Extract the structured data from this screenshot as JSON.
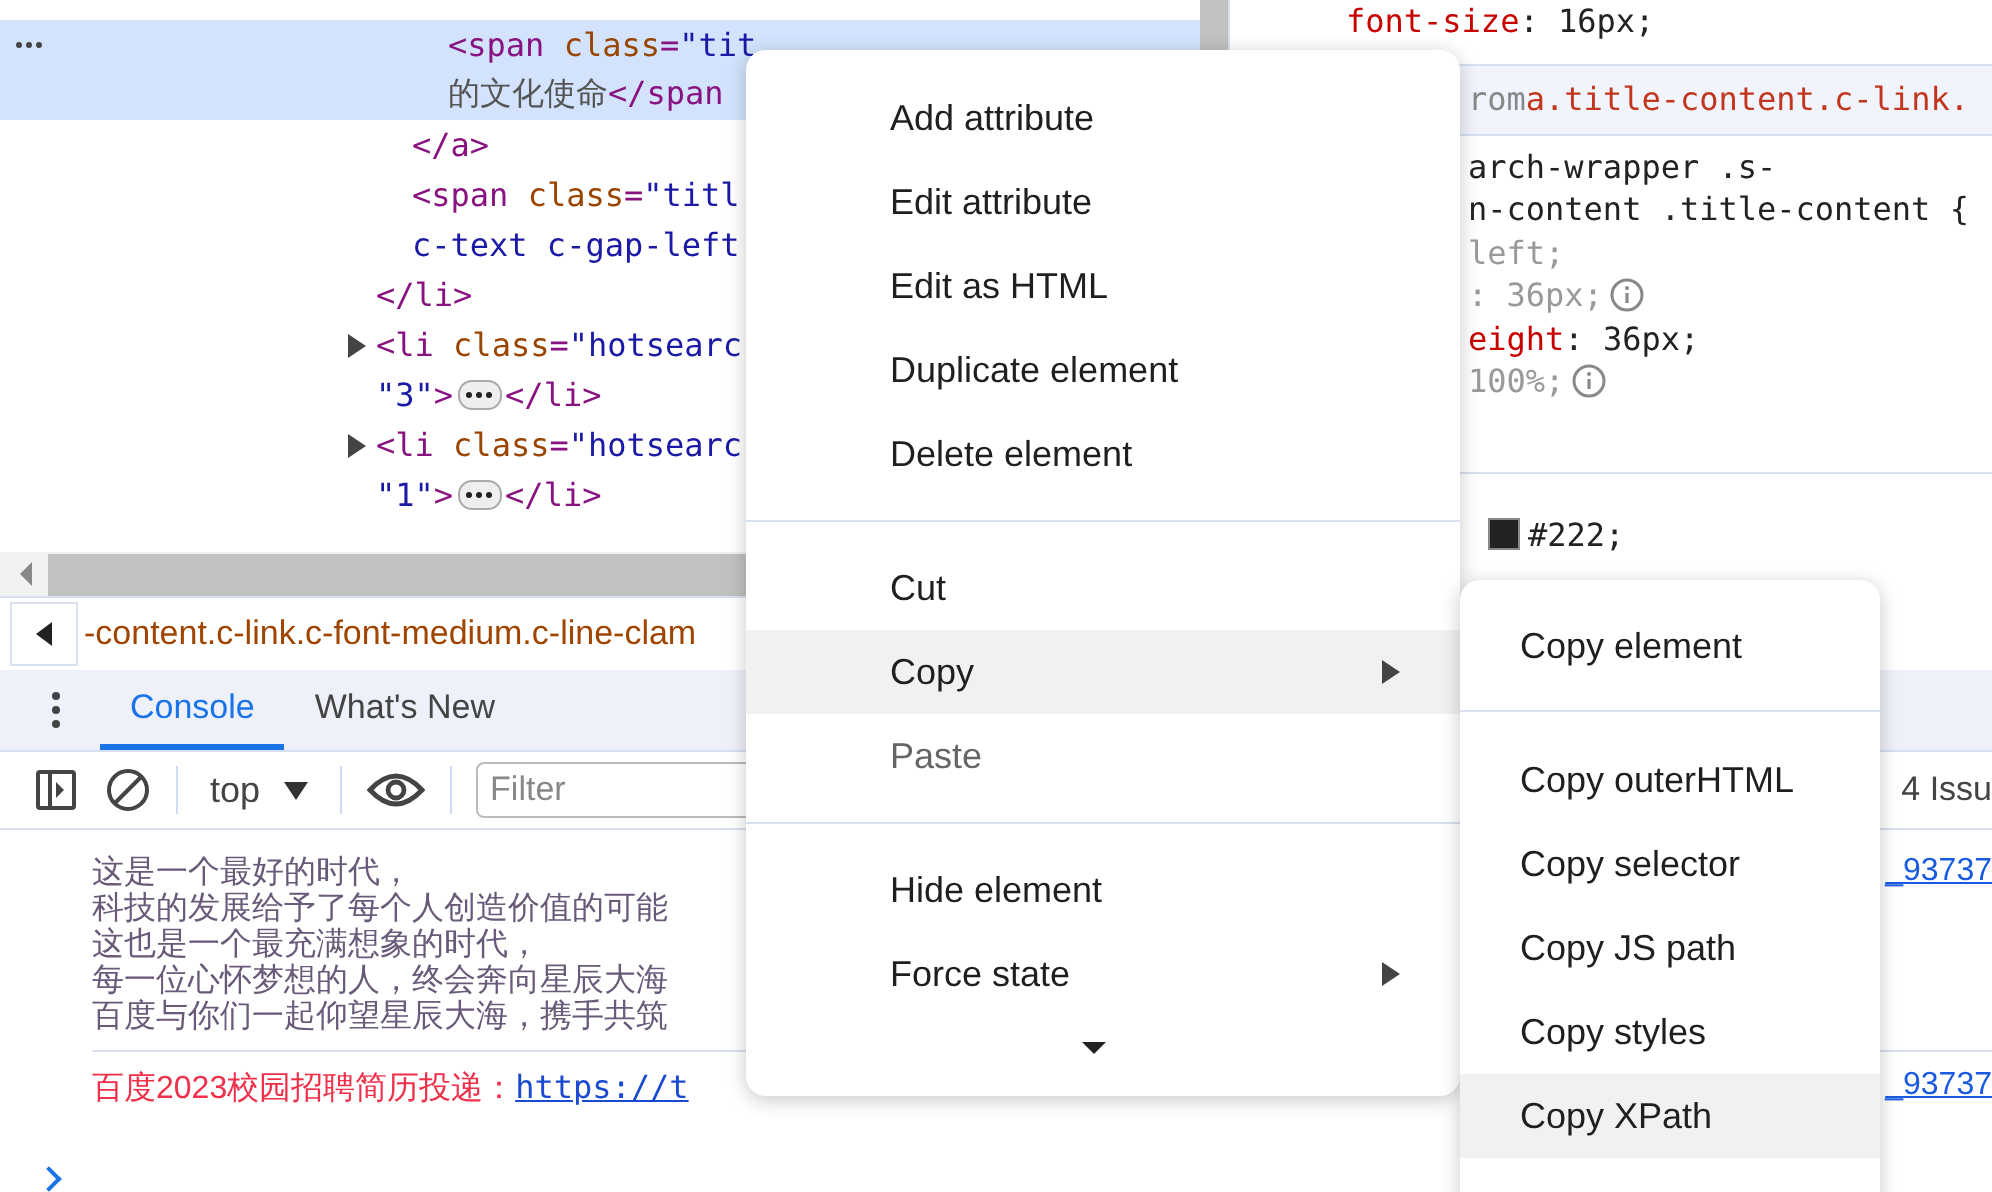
{
  "elements_tree": [
    {
      "close": "</li>",
      "children": [
        {
          "close": "</a>",
          "children": [
            {
              "lines": [
                "<span class=\"tit",
                "的文化使命</span"
              ],
              "selected": true
            }
          ]
        },
        {
          "lines": [
            "<span class=\"titl",
            "c-text c-gap-left"
          ],
          "selected": false
        }
      ]
    },
    {
      "lines": [
        "<li class=\"hotsearc",
        "\"3\">"
      ],
      "collapsed": true,
      "close": "</li>",
      "selected": false
    },
    {
      "lines": [
        "<li class=\"hotsearc",
        "\"1\">"
      ],
      "collapsed": true,
      "close": "</li>",
      "selected": false
    }
  ],
  "breadcrumb": "-content.c-link.c-font-medium.c-line-clam",
  "styles": [
    {
      "kind": "decl",
      "name": "font-size",
      "value": ": 16px;",
      "inactive": false,
      "info": false
    },
    {
      "kind": "header",
      "prefix": "rom",
      "selector": "a.title-content.c-link."
    },
    {
      "kind": "selector",
      "text": "arch-wrapper .s-"
    },
    {
      "kind": "selector",
      "text": "n-content .title-content {"
    },
    {
      "kind": "decl",
      "value": "left;",
      "inactive": true,
      "info": false
    },
    {
      "kind": "decl",
      "value": ": 36px;",
      "inactive": true,
      "info": true
    },
    {
      "kind": "decl",
      "name": "eight",
      "value": ": 36px;",
      "inactive": false,
      "info": false
    },
    {
      "kind": "decl",
      "value": "100%;",
      "inactive": true,
      "info": true
    },
    {
      "kind": "gap"
    },
    {
      "kind": "swatch",
      "color": "#222222",
      "text": "#222;"
    }
  ],
  "drawer_tabs": [
    {
      "label": "Console",
      "selected": true
    },
    {
      "label": "What's New",
      "selected": false
    }
  ],
  "console_toolbar": {
    "context": "top",
    "filter": {
      "placeholder": "Filter"
    },
    "issues": "4 Issu"
  },
  "console_messages": [
    {
      "kind": "log",
      "lines": [
        "这是一个最好的时代，",
        "科技的发展给予了每个人创造价值的可能",
        "这也是一个最充满想象的时代，",
        "每一位心怀梦想的人，终会奔向星辰大海",
        "百度与你们一起仰望星辰大海，携手共筑"
      ],
      "source": "_93737"
    },
    {
      "kind": "red",
      "text": "百度2023校园招聘简历投递：",
      "link": "https://t",
      "source": "_93737"
    }
  ],
  "context_menu": {
    "groups": [
      [
        {
          "label": "Add attribute",
          "kind": "item",
          "selected": false,
          "disabled": false
        },
        {
          "label": "Edit attribute",
          "kind": "item",
          "selected": false,
          "disabled": false
        },
        {
          "label": "Edit as HTML",
          "kind": "item",
          "selected": false,
          "disabled": false
        },
        {
          "label": "Duplicate element",
          "kind": "item",
          "selected": false,
          "disabled": false
        },
        {
          "label": "Delete element",
          "kind": "item",
          "selected": false,
          "disabled": false
        }
      ],
      [
        {
          "label": "Cut",
          "kind": "item",
          "selected": false,
          "disabled": false
        },
        {
          "label": "Copy",
          "kind": "submenu",
          "selected": true,
          "disabled": false
        },
        {
          "label": "Paste",
          "kind": "item",
          "selected": false,
          "disabled": true
        }
      ],
      [
        {
          "label": "Hide element",
          "kind": "item",
          "selected": false,
          "disabled": false
        },
        {
          "label": "Force state",
          "kind": "submenu",
          "selected": false,
          "disabled": false
        }
      ]
    ],
    "more": true
  },
  "copy_submenu": {
    "groups": [
      [
        {
          "label": "Copy element",
          "selected": false
        }
      ],
      [
        {
          "label": "Copy outerHTML",
          "selected": false
        },
        {
          "label": "Copy selector",
          "selected": false
        },
        {
          "label": "Copy JS path",
          "selected": false
        },
        {
          "label": "Copy styles",
          "selected": false
        },
        {
          "label": "Copy XPath",
          "selected": true
        }
      ]
    ]
  }
}
